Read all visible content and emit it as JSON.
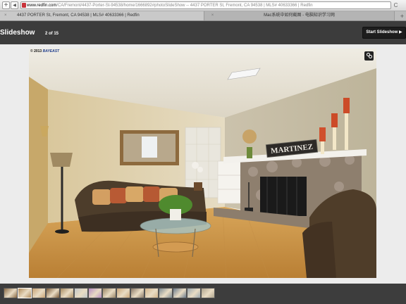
{
  "browser": {
    "url_domain": "www.redfin.com",
    "url_path": "/CA/Fremont/4437-Porter-St-94538/home/1666892#photoSlideShow -- 4437 PORTER St, Fremont, CA 94538 | MLS# 40633366 | Redfin",
    "tabs": [
      {
        "label": "4437 PORTER St, Fremont, CA 94538 | MLS# 40633366 | Redfin",
        "active": true
      },
      {
        "label": "Mac系统中如何截图 - 电脑知识学习网",
        "active": false
      }
    ],
    "nav_add": "+",
    "nav_back": "◀",
    "reload": "C",
    "new_tab": "+",
    "tab_close": "×"
  },
  "slideshow": {
    "title": "Slideshow",
    "counter": "2 of 15",
    "start_button": "Start Slideshow ▶"
  },
  "photo": {
    "copyright": "© 2013",
    "brand": "BAYEAST",
    "sign_text": "MARTINEZ"
  },
  "thumbnails": {
    "count": 15,
    "active_index": 1,
    "colors": [
      "#8a6a45",
      "#b08a5a",
      "#c9a374",
      "#7a5b3a",
      "#a98c62",
      "#c2c7c9",
      "#b88ec4",
      "#9a8565",
      "#caa679",
      "#8b7a68",
      "#d2b48b",
      "#7d8a92",
      "#6b7b8c",
      "#9aa7b0",
      "#b0a58e"
    ]
  }
}
